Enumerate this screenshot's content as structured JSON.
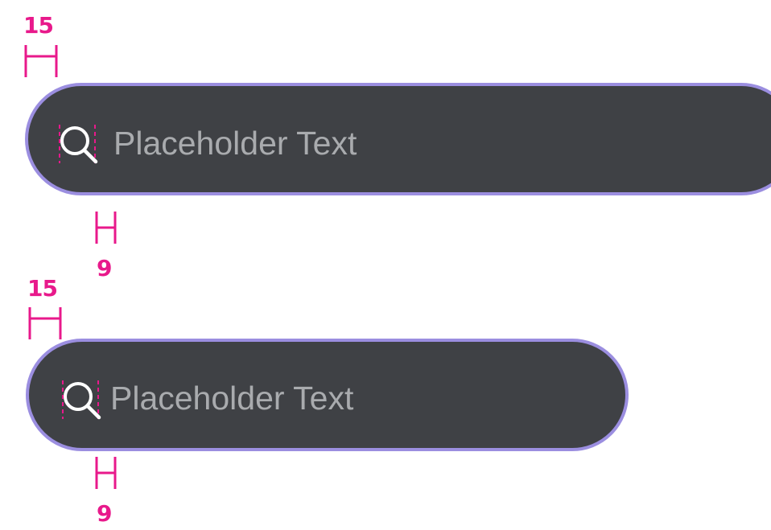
{
  "colors": {
    "annotation": "#e8198b",
    "field_background": "#3f4145",
    "field_border": "#9b8ee0",
    "icon": "#ffffff",
    "placeholder_text": "#a9abae"
  },
  "wide_field": {
    "placeholder": "Placeholder Text",
    "icon": "search-icon",
    "spacing_top_label": "15",
    "spacing_bottom_label": "9"
  },
  "compact_field": {
    "placeholder": "Placeholder Text",
    "icon": "search-icon",
    "spacing_top_label": "15",
    "spacing_bottom_label": "9"
  }
}
